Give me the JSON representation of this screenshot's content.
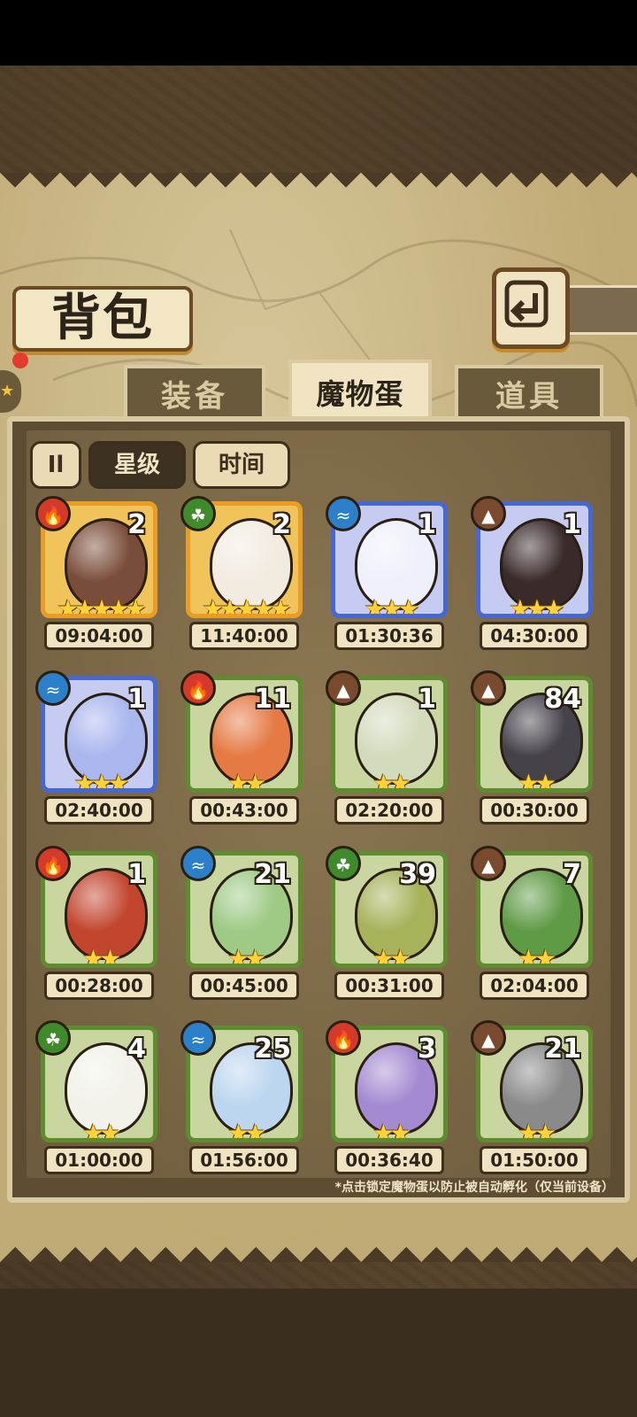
{
  "title": "背包",
  "tabs": [
    {
      "label": "装备",
      "active": false
    },
    {
      "label": "魔物蛋",
      "active": true
    },
    {
      "label": "道具",
      "active": false
    }
  ],
  "sort": {
    "toggle_label": "Il",
    "star_label": "星级",
    "time_label": "时间",
    "active": "星级"
  },
  "eggs": [
    {
      "count": "2",
      "stars": "★★★★★",
      "star_count": 5,
      "timer": "09:04:00",
      "element": "fire-icon",
      "frame": "gold",
      "egg_color": "#7a4d3a"
    },
    {
      "count": "2",
      "stars": "★★★★★",
      "star_count": 5,
      "timer": "11:40:00",
      "element": "leaf-icon",
      "frame": "gold",
      "egg_color": "#f2ece0"
    },
    {
      "count": "1",
      "stars": "★★★",
      "star_count": 3,
      "timer": "01:30:36",
      "element": "water-icon",
      "frame": "blue",
      "egg_color": "#eef1fb"
    },
    {
      "count": "1",
      "stars": "★★★",
      "star_count": 3,
      "timer": "04:30:00",
      "element": "earth-icon",
      "frame": "blue",
      "egg_color": "#3a2a2a"
    },
    {
      "count": "1",
      "stars": "★★★",
      "star_count": 3,
      "timer": "02:40:00",
      "element": "water-icon",
      "frame": "blue",
      "egg_color": "#aab6ee"
    },
    {
      "count": "11",
      "stars": "★★",
      "star_count": 2,
      "timer": "00:43:00",
      "element": "fire-icon",
      "frame": "green",
      "egg_color": "#e57a45"
    },
    {
      "count": "1",
      "stars": "★★",
      "star_count": 2,
      "timer": "02:20:00",
      "element": "earth-icon",
      "frame": "green",
      "egg_color": "#d3dbbd"
    },
    {
      "count": "84",
      "stars": "★★",
      "star_count": 2,
      "timer": "00:30:00",
      "element": "earth-icon",
      "frame": "green",
      "egg_color": "#45424a"
    },
    {
      "count": "1",
      "stars": "★★",
      "star_count": 2,
      "timer": "00:28:00",
      "element": "fire-icon",
      "frame": "green",
      "egg_color": "#c2452e"
    },
    {
      "count": "21",
      "stars": "★★",
      "star_count": 2,
      "timer": "00:45:00",
      "element": "water-icon",
      "frame": "green",
      "egg_color": "#9fca86"
    },
    {
      "count": "39",
      "stars": "★★",
      "star_count": 2,
      "timer": "00:31:00",
      "element": "leaf-icon",
      "frame": "green",
      "egg_color": "#a7b25a"
    },
    {
      "count": "7",
      "stars": "★★",
      "star_count": 2,
      "timer": "02:04:00",
      "element": "earth-icon",
      "frame": "green",
      "egg_color": "#5f9a45"
    },
    {
      "count": "4",
      "stars": "★★",
      "star_count": 2,
      "timer": "01:00:00",
      "element": "leaf-icon",
      "frame": "green",
      "egg_color": "#f2f2ea"
    },
    {
      "count": "25",
      "stars": "★★",
      "star_count": 2,
      "timer": "01:56:00",
      "element": "water-icon",
      "frame": "green",
      "egg_color": "#bcd6ef"
    },
    {
      "count": "3",
      "stars": "★★",
      "star_count": 2,
      "timer": "00:36:40",
      "element": "fire-icon",
      "frame": "green",
      "egg_color": "#a48ad1"
    },
    {
      "count": "21",
      "stars": "★★",
      "star_count": 2,
      "timer": "01:50:00",
      "element": "earth-icon",
      "frame": "green",
      "egg_color": "#8a8a8a"
    }
  ],
  "hint": "*点击锁定魔物蛋以防止被自动孵化（仅当前设备）"
}
